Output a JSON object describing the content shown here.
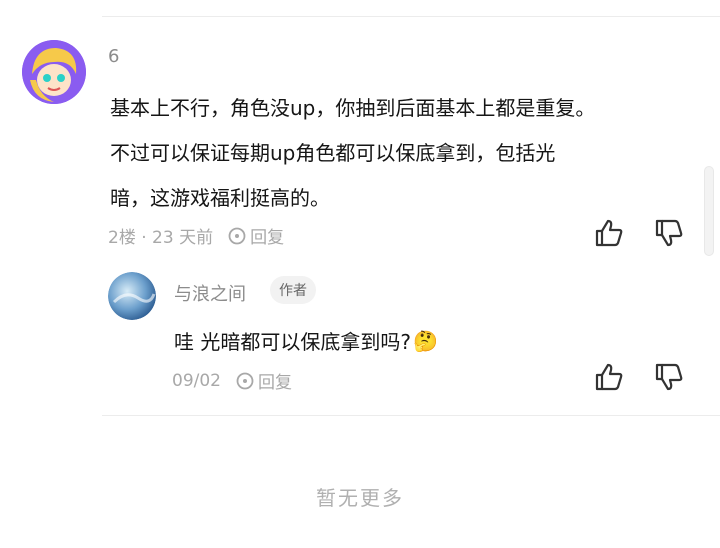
{
  "comment": {
    "username": "6",
    "text_lines": [
      "基本上不行，角色没up，你抽到后面基本上都是重复。",
      "不过可以保证每期up角色都可以保底拿到，包括光",
      "暗，这游戏福利挺高的。"
    ],
    "floor_time": "2楼 · 23 天前",
    "reply_label": "回复"
  },
  "subreply": {
    "username": "与浪之间",
    "badge": "作者",
    "text": "哇 光暗都可以保底拿到吗?",
    "emoji": "🤔",
    "date": "09/02",
    "reply_label": "回复"
  },
  "footer": {
    "empty_text": "暂无更多"
  },
  "colors": {
    "avatar1_bg": "#8a5cf0",
    "avatar2_bg": "#6c9fcc",
    "muted_text": "#a8a8a8",
    "icon_color": "#333333"
  }
}
